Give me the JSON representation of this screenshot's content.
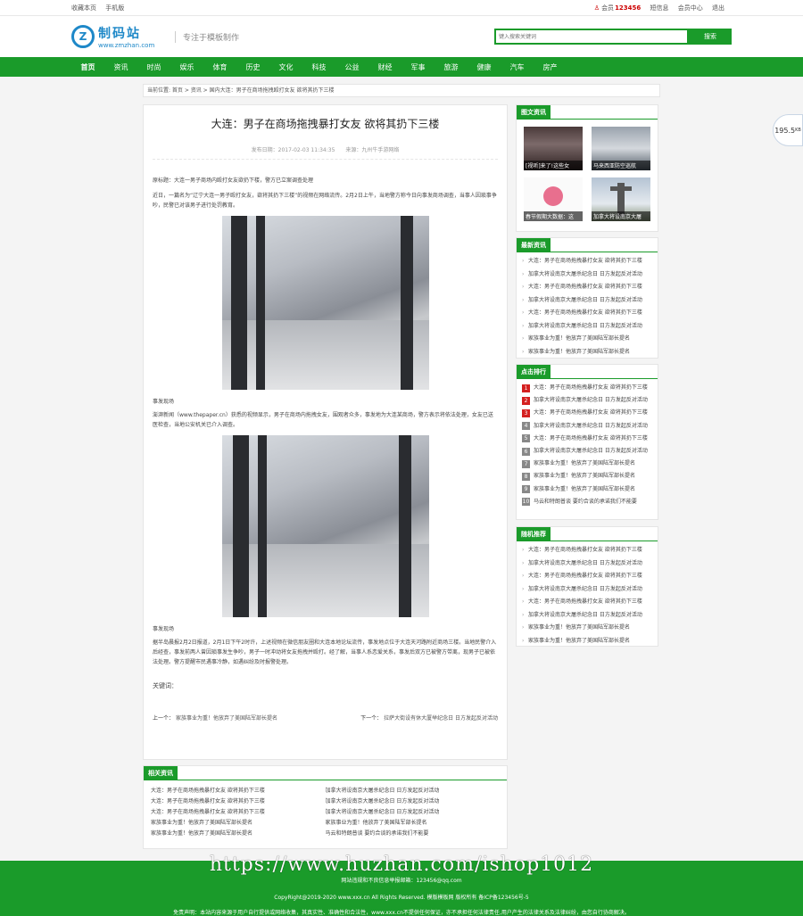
{
  "topbar": {
    "bookmark": "收藏本页",
    "mobile": "手机版",
    "user_prefix": "会员",
    "user_id": "123456",
    "messages": "短信息",
    "member_center": "会员中心",
    "logout": "退出"
  },
  "header": {
    "logo_cn": "制码站",
    "logo_en": "www.zmzhan.com",
    "slogan": "专注于模板制作",
    "search_placeholder": "键入搜索关键词",
    "search_button": "搜索"
  },
  "nav": [
    "首页",
    "资讯",
    "时尚",
    "娱乐",
    "体育",
    "历史",
    "文化",
    "科技",
    "公益",
    "财经",
    "军事",
    "旅游",
    "健康",
    "汽车",
    "房产"
  ],
  "breadcrumb": "当前位置: 首页 > 资讯 > 国内大连：男子在商场拖拽殴打女友 欲将其扔下三楼",
  "article": {
    "title": "大连：男子在商场拖拽暴打女友 欲将其扔下三楼",
    "date": "发布日期：2017-02-03 11:34:35",
    "source": "来源：九州牛手游网络",
    "summary": "原标题：大连一男子商场内殴打女友欲扔下楼，警方已立案调查处理",
    "para1": "近日，一篇名为“辽宁大连一男子殴打女友，欲将其扔下三楼”的视频在网络流传。2月2日上午，当地警方称今日向事发商场调查，当事人因琐事争吵，民警已对该男子进行处罚教育。",
    "caption1": "事发现场",
    "para2": "澎湃新闻（www.thepaper.cn）获悉的视频显示，男子在商场内拖拽女友，围观者众多，事发地为大连某商场，警方表示将依法处理，女友已送医检查，当地公安机关已介入调查。",
    "caption2": "事发现场",
    "para3": "据半岛晨报2月2日报道，2月1日下午2时许，上述视频在微信朋友圈和大连本地论坛流传，事发地点位于大连天河路附近商场三楼。当地民警介入后经查，事发前两人曾因琐事发生争吵，男子一时冲动将女友拖拽并殴打。经了解，当事人系恋爱关系，事发后双方已被警方带离，现男子已被依法处理。警方提醒市民遇事冷静，如遇纠纷及时报警处理。",
    "keywords_label": "关键词：",
    "prev_label": "上一个：",
    "prev_title": "家族事业为重！他放弃了美国陆军部长提名",
    "next_label": "下一个：",
    "next_title": "拉萨大街设有休大厦举纪念日 日方发起反对活动"
  },
  "related": {
    "title": "相关资讯",
    "items": [
      "大连：男子在商场拖拽暴打女友 欲将其扔下三楼",
      "加拿大将设南京大屠杀纪念日 日方发起反对活动",
      "大连：男子在商场拖拽暴打女友 欲将其扔下三楼",
      "加拿大将设南京大屠杀纪念日 日方发起反对活动",
      "大连：男子在商场拖拽暴打女友 欲将其扔下三楼",
      "加拿大将设南京大屠杀纪念日 日方发起反对活动",
      "家族事业为重！他放弃了美国陆军部长提名",
      "家族事业为重！他放弃了美国陆军部长提名",
      "家族事业为重！他放弃了美国陆军部长提名",
      "马云和特朗普谈 要约合谈的承诺我们不能要"
    ]
  },
  "side_pics": {
    "title": "图文资讯",
    "items": [
      "[视听]来了!这些女",
      "马来西亚防空巡航",
      "春节假期大数据：这",
      "加拿大将设南京大屠"
    ]
  },
  "side_latest": {
    "title": "最新资讯",
    "items": [
      "大连：男子在商场拖拽暴打女友 欲将其扔下三楼",
      "加拿大将设南京大屠杀纪念日 日方发起反对活动",
      "大连：男子在商场拖拽暴打女友 欲将其扔下三楼",
      "加拿大将设南京大屠杀纪念日 日方发起反对活动",
      "大连：男子在商场拖拽暴打女友 欲将其扔下三楼",
      "加拿大将设南京大屠杀纪念日 日方发起反对活动",
      "家族事业为重！他放弃了美国陆军部长提名",
      "家族事业为重！他放弃了美国陆军部长提名"
    ]
  },
  "side_hot": {
    "title": "点击排行",
    "items": [
      {
        "n": "1",
        "t": "大连：男子在商场拖拽暴打女友 欲将其扔下三楼"
      },
      {
        "n": "2",
        "t": "加拿大将设南京大屠杀纪念日 日方发起反对活动"
      },
      {
        "n": "3",
        "t": "大连：男子在商场拖拽暴打女友 欲将其扔下三楼"
      },
      {
        "n": "4",
        "t": "加拿大将设南京大屠杀纪念日 日方发起反对活动"
      },
      {
        "n": "5",
        "t": "大连：男子在商场拖拽暴打女友 欲将其扔下三楼"
      },
      {
        "n": "6",
        "t": "加拿大将设南京大屠杀纪念日 日方发起反对活动"
      },
      {
        "n": "7",
        "t": "家族事业为重！他放弃了美国陆军部长提名"
      },
      {
        "n": "8",
        "t": "家族事业为重！他放弃了美国陆军部长提名"
      },
      {
        "n": "9",
        "t": "家族事业为重！他放弃了美国陆军部长提名"
      },
      {
        "n": "10",
        "t": "马云和特朗普谈 要约合谈的承诺我们不能要"
      }
    ]
  },
  "side_random": {
    "title": "随机推荐",
    "items": [
      "大连：男子在商场拖拽暴打女友 欲将其扔下三楼",
      "加拿大将设南京大屠杀纪念日 日方发起反对活动",
      "大连：男子在商场拖拽暴打女友 欲将其扔下三楼",
      "加拿大将设南京大屠杀纪念日 日方发起反对活动",
      "大连：男子在商场拖拽暴打女友 欲将其扔下三楼",
      "加拿大将设南京大屠杀纪念日 日方发起反对活动",
      "家族事业为重！他放弃了美国陆军部长提名",
      "家族事业为重！他放弃了美国陆军部长提名"
    ]
  },
  "float_badge": {
    "value": "195.5",
    "unit": "KB"
  },
  "footer": {
    "watermark": "https://www.huzhan.com/ishop1012",
    "contact": "网站违规和不良信息举报邮箱：123456@qq.com",
    "copyright": "CopyRight@2019-2020 www.xxx.cn All Rights Reserved.  模版模板网  版权所有  备ICP备123456号-5",
    "disclaimer": "免责声明：本站内容来源于用户自行提供或网络收集，其真实性、准确性和合法性，www.xxx.cn不提供任何保证，亦不承担任何法律责任,用户产生的法律关系及法律纠纷，由您自行协商解决。"
  },
  "colors": {
    "brand_green": "#1a9b2a",
    "logo_blue": "#1e88c8",
    "rank_hot": "#d42020"
  }
}
